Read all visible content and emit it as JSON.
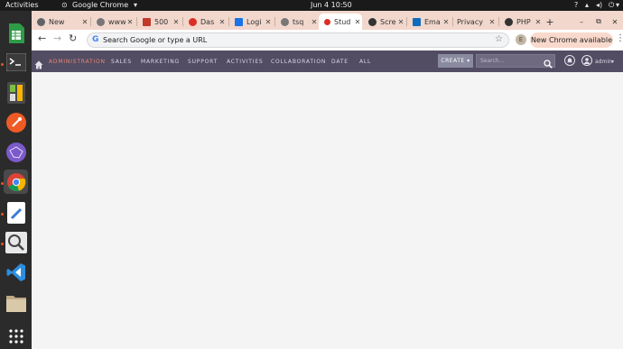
{
  "system": {
    "activities": "Activities",
    "app_name": "Google Chrome",
    "clock": "Jun 4  10:50"
  },
  "dock": {
    "apps": [
      "spreadsheet",
      "terminal",
      "calculator",
      "postman",
      "network-tool",
      "chrome",
      "text-editor",
      "image-viewer",
      "vscode",
      "files",
      "app-grid"
    ]
  },
  "tabs": [
    {
      "title": "New",
      "fav_color": "#5f6368"
    },
    {
      "title": "www",
      "fav_color": "#777777"
    },
    {
      "title": "500",
      "fav_color": "#c0392b"
    },
    {
      "title": "Das",
      "fav_color": "#d93025"
    },
    {
      "title": "Logi",
      "fav_color": "#1a73e8"
    },
    {
      "title": "tsq",
      "fav_color": "#777777"
    },
    {
      "title": "Stud",
      "fav_color": "#d93025",
      "active": true
    },
    {
      "title": "Scre",
      "fav_color": "#333333"
    },
    {
      "title": "Ema",
      "fav_color": "#0f6cbd"
    },
    {
      "title": "Privacy",
      "fav_color": ""
    },
    {
      "title": "PHP",
      "fav_color": "#333333"
    }
  ],
  "browser": {
    "new_tab": "+",
    "omnibox_placeholder": "Search Google or type a URL",
    "profile_initial": "E",
    "update_label": "New Chrome available"
  },
  "app": {
    "nav": [
      "ADMINISTRATION",
      "SALES",
      "MARKETING",
      "SUPPORT",
      "ACTIVITIES",
      "COLLABORATION",
      "DATE",
      "ALL"
    ],
    "create_label": "CREATE",
    "search_placeholder": "Search...",
    "user_label": "admin"
  }
}
